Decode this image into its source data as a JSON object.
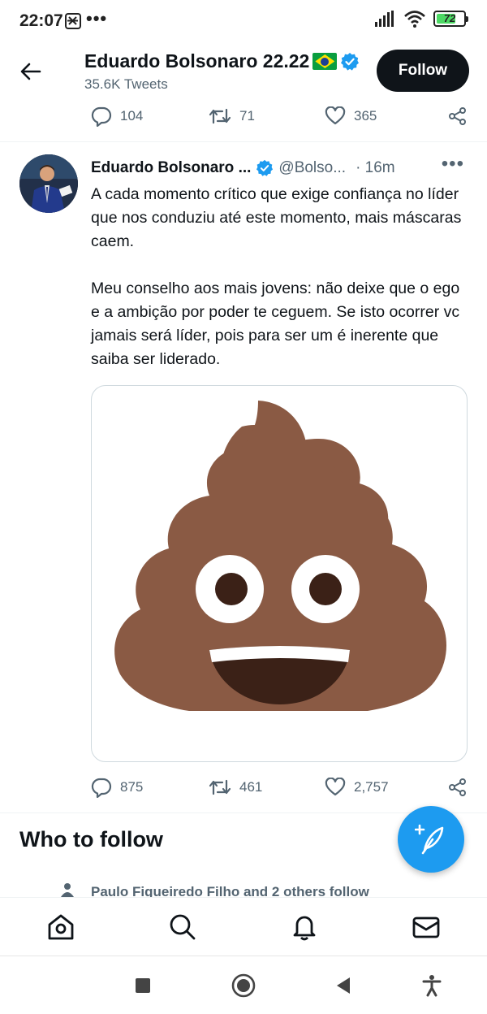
{
  "status_bar": {
    "time": "22:07",
    "dots": "•••",
    "battery": "72"
  },
  "header": {
    "name": "Eduardo Bolsonaro 22.22",
    "tweet_count": "35.6K Tweets",
    "follow_label": "Follow"
  },
  "prev_tweet_actions": {
    "replies": "104",
    "retweets": "71",
    "likes": "365"
  },
  "tweet": {
    "name": "Eduardo Bolsonaro ...",
    "handle": "@Bolso...",
    "time": "· 16m",
    "more": "•••",
    "text": "A cada momento crítico que exige confiança no líder que nos conduziu até este momento, mais máscaras caem.\n\nMeu conselho aos mais jovens: não deixe que o ego e a ambição por poder te ceguem. Se isto ocorrer vc jamais será líder, pois para ser um é inerente que saiba ser liderado.",
    "media": "pile-of-poo-emoji",
    "actions": {
      "replies": "875",
      "retweets": "461",
      "likes": "2,757"
    }
  },
  "who_to_follow": {
    "title": "Who to follow",
    "social_context": "Paulo Figueiredo Filho and 2 others follow"
  },
  "colors": {
    "accent": "#1d9bf0",
    "text": "#0f1419",
    "secondary": "#536471",
    "poo": "#8a5a44"
  },
  "icons": {
    "bottom_nav": [
      "home-icon",
      "search-icon",
      "notifications-icon",
      "messages-icon"
    ],
    "android_nav": [
      "recents-icon",
      "home-circle-icon",
      "back-triangle-icon",
      "accessibility-icon"
    ]
  }
}
